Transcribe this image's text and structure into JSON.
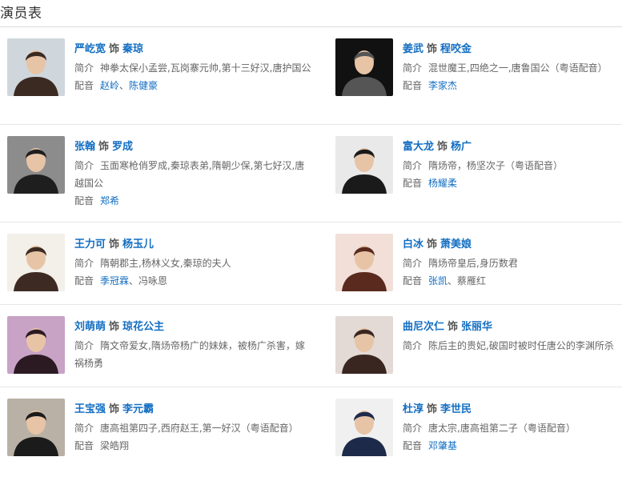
{
  "page_title": "演员表",
  "labels": {
    "as": "饰",
    "intro": "简介",
    "dub": "配音"
  },
  "cast": [
    {
      "actor": "严屹宽",
      "role": "秦琼",
      "intro": "神拳太保小孟尝,瓦岗寨元帅,第十三好汉,唐护国公",
      "dub": [
        {
          "name": "赵岭",
          "link": true
        },
        {
          "name": "陈健豪",
          "link": true
        }
      ],
      "photo_bg": "#cfd6dc",
      "photo_fg": "#3a2a22"
    },
    {
      "actor": "姜武",
      "role": "程咬金",
      "intro": "混世魔王,四绝之一,唐鲁国公（粤语配音）",
      "dub": [
        {
          "name": "李家杰",
          "link": true
        }
      ],
      "photo_bg": "#111111",
      "photo_fg": "#555555"
    },
    {
      "actor": "张翰",
      "role": "罗成",
      "intro": "玉面寒枪俏罗成,秦琼表弟,隋朝少保,第七好汉,唐越国公",
      "dub": [
        {
          "name": "郑希",
          "link": true
        }
      ],
      "photo_bg": "#8c8c8c",
      "photo_fg": "#1e1e1e"
    },
    {
      "actor": "富大龙",
      "role": "杨广",
      "intro": "隋炀帝，杨坚次子（粤语配音）",
      "dub": [
        {
          "name": "杨耀柔",
          "link": true
        }
      ],
      "photo_bg": "#e9e9e9",
      "photo_fg": "#1a1a1a"
    },
    {
      "actor": "王力可",
      "role": "杨玉儿",
      "intro": "隋朝郡主,杨林义女,秦琼的夫人",
      "dub": [
        {
          "name": "季冠霖",
          "link": true
        },
        {
          "name": "冯咏恩",
          "link": false
        }
      ],
      "photo_bg": "#f3efe9",
      "photo_fg": "#3d2b23"
    },
    {
      "actor": "白冰",
      "role": "萧美娘",
      "intro": "隋炀帝皇后,身历数君",
      "dub": [
        {
          "name": "张凯",
          "link": true
        },
        {
          "name": "蔡雁红",
          "link": false
        }
      ],
      "photo_bg": "#f1dfd8",
      "photo_fg": "#5a2a1e"
    },
    {
      "actor": "刘萌萌",
      "role": "琼花公主",
      "intro": "隋文帝爱女,隋炀帝杨广的妹妹，被杨广杀害，嫁祸杨勇",
      "dub": [],
      "photo_bg": "#c8a3c6",
      "photo_fg": "#2b1a22"
    },
    {
      "actor": "曲尼次仁",
      "role": "张丽华",
      "intro": "陈后主的贵妃,破国时被时任唐公的李渊所杀",
      "dub": [],
      "photo_bg": "#e3dad5",
      "photo_fg": "#3a2620"
    },
    {
      "actor": "王宝强",
      "role": "李元霸",
      "intro": "唐高祖第四子,西府赵王,第一好汉（粤语配音）",
      "dub": [
        {
          "name": "梁皓翔",
          "link": false
        }
      ],
      "photo_bg": "#b9b1a5",
      "photo_fg": "#1b1b1b"
    },
    {
      "actor": "杜淳",
      "role": "李世民",
      "intro": "唐太宗,唐高祖第二子（粤语配音）",
      "dub": [
        {
          "name": "邓肇基",
          "link": true
        }
      ],
      "photo_bg": "#f0f0f0",
      "photo_fg": "#1d2a4a"
    }
  ]
}
